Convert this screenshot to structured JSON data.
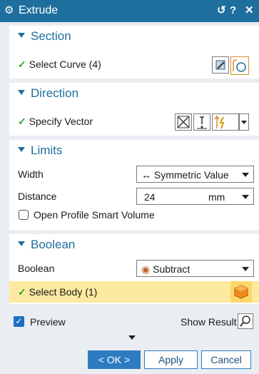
{
  "window": {
    "title": "Extrude"
  },
  "titlebar": {
    "reset_glyph": "↺",
    "help_glyph": "?",
    "close_glyph": "✕"
  },
  "section": {
    "heading": "Section",
    "select_curve_label": "Select Curve (4)"
  },
  "direction": {
    "heading": "Direction",
    "specify_vector_label": "Specify Vector"
  },
  "limits": {
    "heading": "Limits",
    "width_label": "Width",
    "width_value": "Symmetric Value",
    "distance_label": "Distance",
    "distance_value": "24",
    "distance_unit": "mm",
    "open_profile_label": "Open Profile Smart Volume"
  },
  "boolean": {
    "heading": "Boolean",
    "boolean_label": "Boolean",
    "boolean_value": "Subtract",
    "select_body_label": "Select Body (1)"
  },
  "footer": {
    "preview_label": "Preview",
    "show_result_label": "Show Result",
    "ok_label": "< OK >",
    "apply_label": "Apply",
    "cancel_label": "Cancel"
  },
  "colors": {
    "accent": "#1f6f9e",
    "check": "#2aa82a",
    "highlight": "#fde9a0",
    "body_icon": "#f08a1c"
  }
}
